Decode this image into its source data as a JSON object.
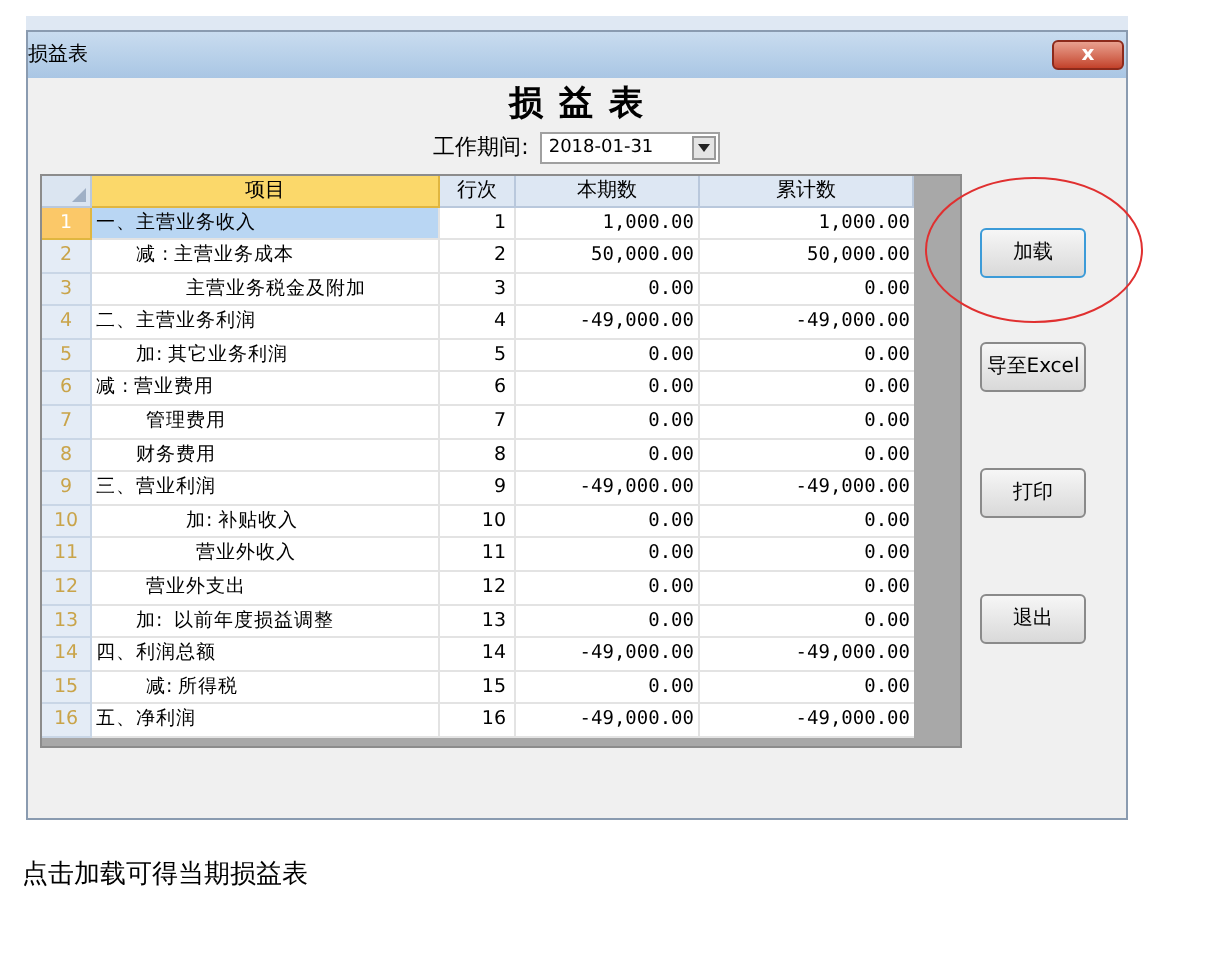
{
  "window": {
    "title": "损益表",
    "close_label": "x"
  },
  "heading": "损 益 表",
  "period": {
    "label": "工作期间:",
    "value": "2018-01-31"
  },
  "table": {
    "columns": [
      {
        "label": "项目",
        "selected": true
      },
      {
        "label": "行次",
        "selected": false
      },
      {
        "label": "本期数",
        "selected": false
      },
      {
        "label": "累计数",
        "selected": false
      }
    ],
    "rows": [
      {
        "num": "1",
        "item": "一、主营业务收入",
        "kind": "main",
        "line": "1",
        "current": "1,000.00",
        "total": "1,000.00",
        "selected": true
      },
      {
        "num": "2",
        "item": "减 : 主营业务成本",
        "kind": "sub",
        "line": "2",
        "current": "50,000.00",
        "total": "50,000.00",
        "selected": false
      },
      {
        "num": "3",
        "item": "主营业务税金及附加",
        "kind": "deep",
        "line": "3",
        "current": "0.00",
        "total": "0.00",
        "selected": false
      },
      {
        "num": "4",
        "item": "二、主营业务利润",
        "kind": "main",
        "line": "4",
        "current": "-49,000.00",
        "total": "-49,000.00",
        "selected": false
      },
      {
        "num": "5",
        "item": "加: 其它业务利润",
        "kind": "sub",
        "line": "5",
        "current": "0.00",
        "total": "0.00",
        "selected": false
      },
      {
        "num": "6",
        "item": "减 : 营业费用",
        "kind": "main",
        "line": "6",
        "current": "0.00",
        "total": "0.00",
        "selected": false
      },
      {
        "num": "7",
        "item": "管理费用",
        "kind": "mid",
        "line": "7",
        "current": "0.00",
        "total": "0.00",
        "selected": false
      },
      {
        "num": "8",
        "item": "财务费用",
        "kind": "sub",
        "line": "8",
        "current": "0.00",
        "total": "0.00",
        "selected": false
      },
      {
        "num": "9",
        "item": "三、营业利润",
        "kind": "main",
        "line": "9",
        "current": "-49,000.00",
        "total": "-49,000.00",
        "selected": false
      },
      {
        "num": "10",
        "item": "加: 补贴收入",
        "kind": "deep",
        "line": "10",
        "current": "0.00",
        "total": "0.00",
        "selected": false
      },
      {
        "num": "11",
        "item": "营业外收入",
        "kind": "deeper",
        "line": "11",
        "current": "0.00",
        "total": "0.00",
        "selected": false
      },
      {
        "num": "12",
        "item": "营业外支出",
        "kind": "mid",
        "line": "12",
        "current": "0.00",
        "total": "0.00",
        "selected": false
      },
      {
        "num": "13",
        "item": "加:  以前年度损益调整",
        "kind": "sub",
        "line": "13",
        "current": "0.00",
        "total": "0.00",
        "selected": false
      },
      {
        "num": "14",
        "item": "四、利润总额",
        "kind": "main",
        "line": "14",
        "current": "-49,000.00",
        "total": "-49,000.00",
        "selected": false
      },
      {
        "num": "15",
        "item": "减: 所得税",
        "kind": "mid",
        "line": "15",
        "current": "0.00",
        "total": "0.00",
        "selected": false
      },
      {
        "num": "16",
        "item": "五、净利润",
        "kind": "main",
        "line": "16",
        "current": "-49,000.00",
        "total": "-49,000.00",
        "selected": false
      }
    ]
  },
  "buttons": [
    {
      "label": "加载",
      "focused": true,
      "circled": true
    },
    {
      "label": "导至Excel",
      "focused": false,
      "circled": false
    },
    {
      "label": "打印",
      "focused": false,
      "circled": false
    },
    {
      "label": "退出",
      "focused": false,
      "circled": false
    }
  ],
  "caption": "点击加载可得当期损益表"
}
